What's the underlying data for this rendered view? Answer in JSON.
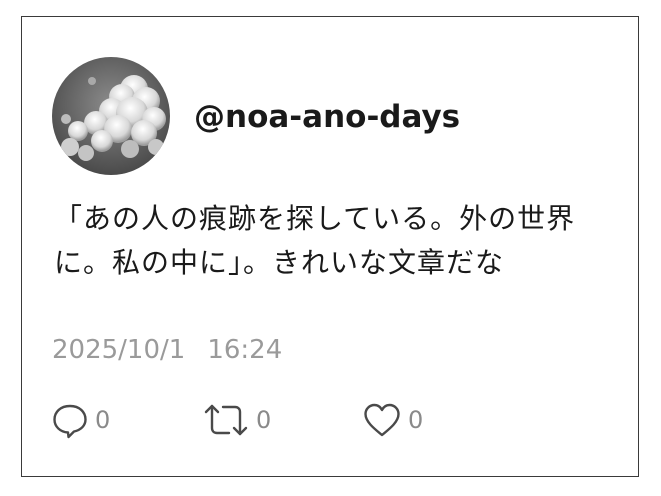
{
  "post": {
    "username": "@noa-ano-days",
    "message": "「あの人の痕跡を探している。外の世界に。私の中に」。きれいな文章だな",
    "date": "2025/10/1",
    "time": "16:24"
  },
  "actions": {
    "reply_count": "0",
    "retweet_count": "0",
    "like_count": "0"
  },
  "icons": {
    "avatar": "cloud-photo",
    "reply": "speech-bubble-icon",
    "retweet": "retweet-icon",
    "like": "heart-icon"
  },
  "colors": {
    "text": "#1a1a1a",
    "muted": "#9a9a9a",
    "border": "#3a3a3a"
  }
}
